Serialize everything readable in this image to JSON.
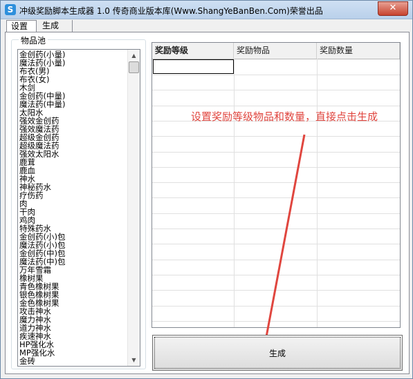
{
  "window": {
    "title": "冲级奖励脚本生成器 1.0 传奇商业版本库(Www.ShangYeBanBen.Com)荣誉出品",
    "icon_letter": "S",
    "close_glyph": "✕"
  },
  "tabs": [
    {
      "label": "设置"
    },
    {
      "label": "生成"
    }
  ],
  "item_pool": {
    "title": "物品池",
    "items": [
      "金创药(小量)",
      "魔法药(小量)",
      "布衣(男)",
      "布衣(女)",
      "木剑",
      "金创药(中量)",
      "魔法药(中量)",
      "太阳水",
      "强效金创药",
      "强效魔法药",
      "超级金创药",
      "超级魔法药",
      "强效太阳水",
      "鹿茸",
      "鹿血",
      "神水",
      "神秘药水",
      "疗伤药",
      "肉",
      "干肉",
      "鸡肉",
      "特殊药水",
      "金创药(小)包",
      "魔法药(小)包",
      "金创药(中)包",
      "魔法药(中)包",
      "万年雪霜",
      "橡树果",
      "青色橡树果",
      "银色橡树果",
      "金色橡树果",
      "攻击神水",
      "魔力神水",
      "道力神水",
      "疾速神水",
      "HP强化水",
      "MP强化水",
      "金砖"
    ]
  },
  "reward_table": {
    "columns": [
      "奖励等级",
      "奖励物品",
      "奖励数量"
    ]
  },
  "annotation": "设置奖励等级物品和数量，直接点击生成",
  "generate_button": {
    "label": "生成"
  },
  "colors": {
    "annotation": "#e0463f"
  }
}
